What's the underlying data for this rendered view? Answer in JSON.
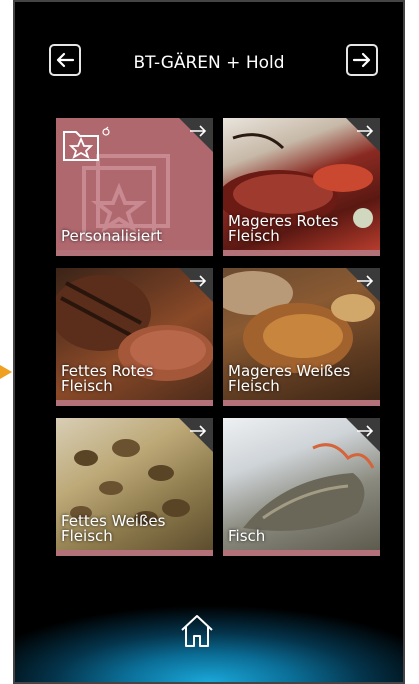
{
  "header": {
    "title": "BT-GÄREN + Hold"
  },
  "tiles": [
    {
      "label": "Personalisiert",
      "icon": "favorites-folder-icon"
    },
    {
      "label": "Mageres Rotes Fleisch"
    },
    {
      "label": "Fettes Rotes Fleisch"
    },
    {
      "label": "Mageres Weißes Fleisch"
    },
    {
      "label": "Fettes Weißes Fleisch"
    },
    {
      "label": "Fisch"
    }
  ],
  "icons": {
    "prev": "arrow-left-icon",
    "next": "arrow-right-icon",
    "home": "home-icon",
    "tile_arrow": "arrow-right-icon"
  },
  "colors": {
    "background": "#000000",
    "tile_bar": "#b3727a",
    "personal_tile": "#b0686f",
    "home_glow": "#1aa7d8",
    "side_arrow": "#f0a020"
  }
}
